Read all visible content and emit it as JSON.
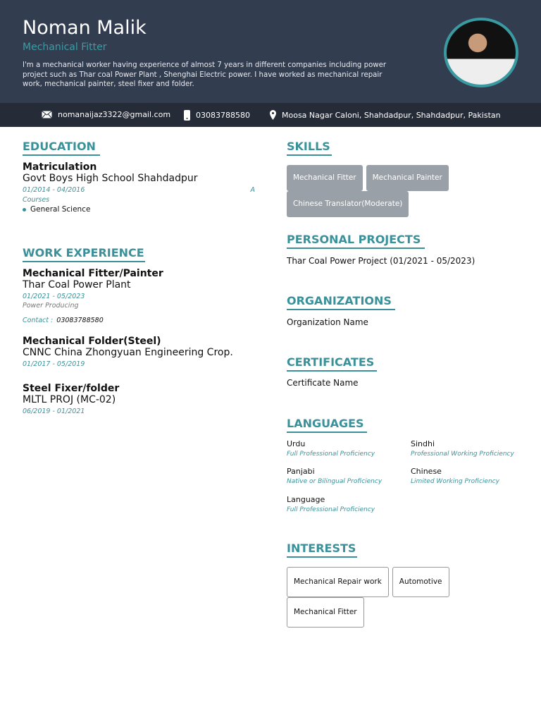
{
  "header": {
    "name": "Noman Malik",
    "title": "Mechanical Fitter",
    "summary": "I'm a mechanical worker having experience of almost 7 years in different companies including power project such as Thar coal Power Plant , Shenghai Electric power. I have worked as mechanical repair work, mechanical painter, steel fixer and folder."
  },
  "contact": {
    "email": "nomanaijaz3322@gmail.com",
    "phone": "03083788580",
    "address": "Moosa Nagar Caloni, Shahdadpur, Shahdadpur, Pakistan"
  },
  "education": {
    "heading": "EDUCATION",
    "degree": "Matriculation",
    "school": "Govt Boys High School Shahdadpur",
    "dates": "01/2014 - 04/2016",
    "grade": "A",
    "courses_label": "Courses",
    "courses": [
      "General Science"
    ]
  },
  "work": {
    "heading": "WORK EXPERIENCE",
    "items": [
      {
        "role": "Mechanical Fitter/Painter",
        "company": "Thar Coal Power Plant",
        "dates": "01/2021 - 05/2023",
        "desc": "Power Producing",
        "contact_label": "Contact :",
        "contact": "03083788580"
      },
      {
        "role": "Mechanical Folder(Steel)",
        "company": "CNNC China Zhongyuan Engineering Crop.",
        "dates": "01/2017 - 05/2019"
      },
      {
        "role": "Steel Fixer/folder",
        "company": "MLTL PROJ (MC-02)",
        "dates": "06/2019 - 01/2021"
      }
    ]
  },
  "skills": {
    "heading": "SKILLS",
    "items": [
      "Mechanical Fitter",
      "Mechanical Painter",
      "Chinese Translator(Moderate)"
    ]
  },
  "projects": {
    "heading": "PERSONAL PROJECTS",
    "item": "Thar Coal Power Project (01/2021 - 05/2023)"
  },
  "organizations": {
    "heading": "ORGANIZATIONS",
    "item": "Organization Name"
  },
  "certificates": {
    "heading": "CERTIFICATES",
    "item": "Certificate Name"
  },
  "languages": {
    "heading": "LANGUAGES",
    "items": [
      {
        "name": "Urdu",
        "level": "Full Professional Proficiency"
      },
      {
        "name": "Sindhi",
        "level": "Professional Working Proficiency"
      },
      {
        "name": "Panjabi",
        "level": "Native or Bilingual Proficiency"
      },
      {
        "name": "Chinese",
        "level": "Limited Working Proficiency"
      },
      {
        "name": "Language",
        "level": "Full Professional Proficiency"
      }
    ]
  },
  "interests": {
    "heading": "INTERESTS",
    "items": [
      "Mechanical Repair work",
      "Automotive",
      "Mechanical Fitter"
    ]
  },
  "colors": {
    "header": "#333d50",
    "accent": "#3a9199"
  }
}
